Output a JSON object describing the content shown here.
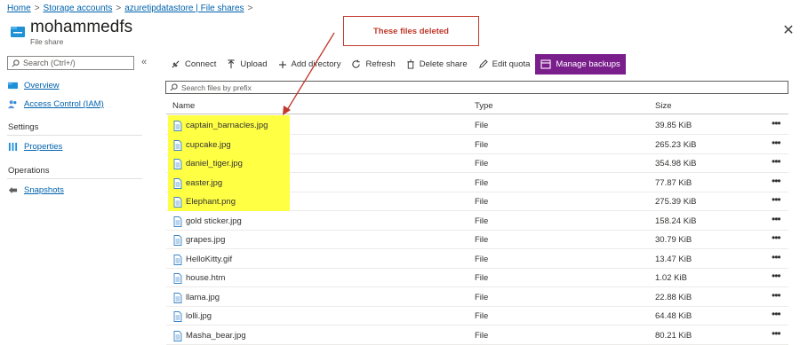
{
  "breadcrumb": [
    {
      "label": "Home"
    },
    {
      "label": "Storage accounts"
    },
    {
      "label": "azuretipdatastore | File shares"
    }
  ],
  "breadcrumb_separator": ">",
  "header": {
    "title": "mohammedfs",
    "subtitle": "File share"
  },
  "sidebar": {
    "search_placeholder": "Search (Ctrl+/)",
    "collapse_glyph": "«",
    "items_top": [
      {
        "label": "Overview",
        "icon": "cloud-icon"
      },
      {
        "label": "Access Control (IAM)",
        "icon": "people-icon"
      }
    ],
    "sections": [
      {
        "title": "Settings",
        "items": [
          {
            "label": "Properties",
            "icon": "bars-icon"
          }
        ]
      },
      {
        "title": "Operations",
        "items": [
          {
            "label": "Snapshots",
            "icon": "snapshot-icon"
          }
        ]
      }
    ]
  },
  "toolbar": {
    "connect": "Connect",
    "upload": "Upload",
    "add_directory": "Add directory",
    "refresh": "Refresh",
    "delete_share": "Delete share",
    "edit_quota": "Edit quota",
    "manage_backups": "Manage backups"
  },
  "file_search": {
    "placeholder": "Search files by prefix"
  },
  "table": {
    "columns": [
      "Name",
      "Type",
      "Size"
    ],
    "rows": [
      {
        "name": "captain_barnacles.jpg",
        "type": "File",
        "size": "39.85 KiB",
        "highlighted": true
      },
      {
        "name": "cupcake.jpg",
        "type": "File",
        "size": "265.23 KiB",
        "highlighted": true
      },
      {
        "name": "daniel_tiger.jpg",
        "type": "File",
        "size": "354.98 KiB",
        "highlighted": true
      },
      {
        "name": "easter.jpg",
        "type": "File",
        "size": "77.87 KiB",
        "highlighted": true
      },
      {
        "name": "Elephant.png",
        "type": "File",
        "size": "275.39 KiB",
        "highlighted": true
      },
      {
        "name": "gold sticker.jpg",
        "type": "File",
        "size": "158.24 KiB",
        "highlighted": false
      },
      {
        "name": "grapes.jpg",
        "type": "File",
        "size": "30.79 KiB",
        "highlighted": false
      },
      {
        "name": "HelloKitty.gif",
        "type": "File",
        "size": "13.47 KiB",
        "highlighted": false
      },
      {
        "name": "house.htm",
        "type": "File",
        "size": "1.02 KiB",
        "highlighted": false
      },
      {
        "name": "llama.jpg",
        "type": "File",
        "size": "22.88 KiB",
        "highlighted": false
      },
      {
        "name": "lolli.jpg",
        "type": "File",
        "size": "64.48 KiB",
        "highlighted": false
      },
      {
        "name": "Masha_bear.jpg",
        "type": "File",
        "size": "80.21 KiB",
        "highlighted": false
      }
    ],
    "more_glyph": "•••"
  },
  "annotation": {
    "text": "These files deleted",
    "color": "#c0392b"
  },
  "colors": {
    "accent": "#7a1e8c",
    "link": "#0062ad",
    "highlight": "#ffff44",
    "azure_blue": "#1e90d6"
  }
}
